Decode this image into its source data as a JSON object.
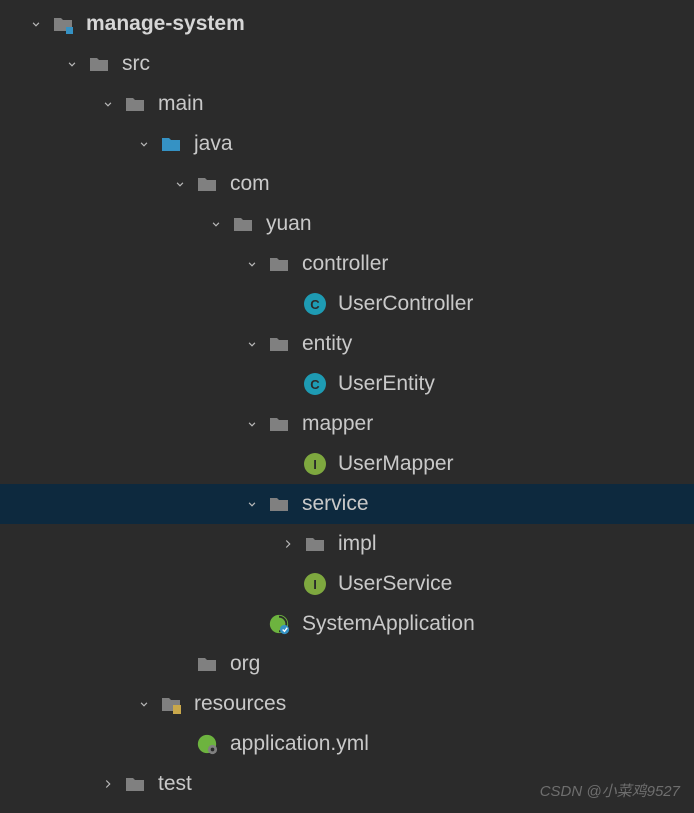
{
  "tree": {
    "root": {
      "label": "manage-system"
    },
    "src": {
      "label": "src"
    },
    "main": {
      "label": "main"
    },
    "java": {
      "label": "java"
    },
    "com": {
      "label": "com"
    },
    "yuan": {
      "label": "yuan"
    },
    "controller": {
      "label": "controller"
    },
    "userController": {
      "label": "UserController"
    },
    "entity": {
      "label": "entity"
    },
    "userEntity": {
      "label": "UserEntity"
    },
    "mapper": {
      "label": "mapper"
    },
    "userMapper": {
      "label": "UserMapper"
    },
    "service": {
      "label": "service"
    },
    "impl": {
      "label": "impl"
    },
    "userService": {
      "label": "UserService"
    },
    "systemApplication": {
      "label": "SystemApplication"
    },
    "org": {
      "label": "org"
    },
    "resources": {
      "label": "resources"
    },
    "appYml": {
      "label": "application.yml"
    },
    "test": {
      "label": "test"
    }
  },
  "watermark": "CSDN @小菜鸡9527",
  "icons": {
    "classLetter": "C",
    "interfaceLetter": "I"
  }
}
